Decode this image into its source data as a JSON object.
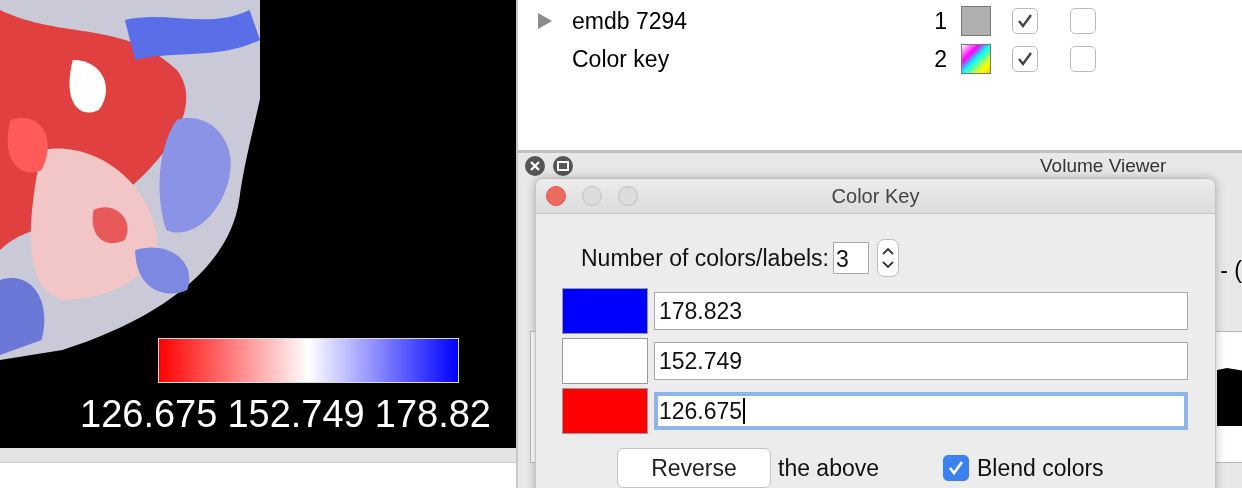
{
  "key_overlay": {
    "labels": [
      "126.675",
      "152.749",
      "178.82"
    ]
  },
  "models": [
    {
      "kind": "map",
      "name": "emdb 7294",
      "id": "1",
      "color": "#b0b0b0",
      "check_a": true,
      "check_b": false
    },
    {
      "kind": "key",
      "name": "Color key",
      "id": "2",
      "check_a": true,
      "check_b": false
    }
  ],
  "volume_viewer": {
    "title": "Volume Viewer",
    "fragment": "- ("
  },
  "dialog": {
    "title": "Color Key",
    "count_label": "Number of colors/labels:",
    "count": "3",
    "entries": [
      {
        "color": "#0000ff",
        "value": "178.823",
        "focused": false
      },
      {
        "color": "#ffffff",
        "value": "152.749",
        "focused": false
      },
      {
        "color": "#ff0000",
        "value": "126.675",
        "focused": true
      }
    ],
    "reverse_button": "Reverse",
    "reverse_note": "the above",
    "blend": {
      "label": "Blend colors",
      "checked": true
    }
  }
}
